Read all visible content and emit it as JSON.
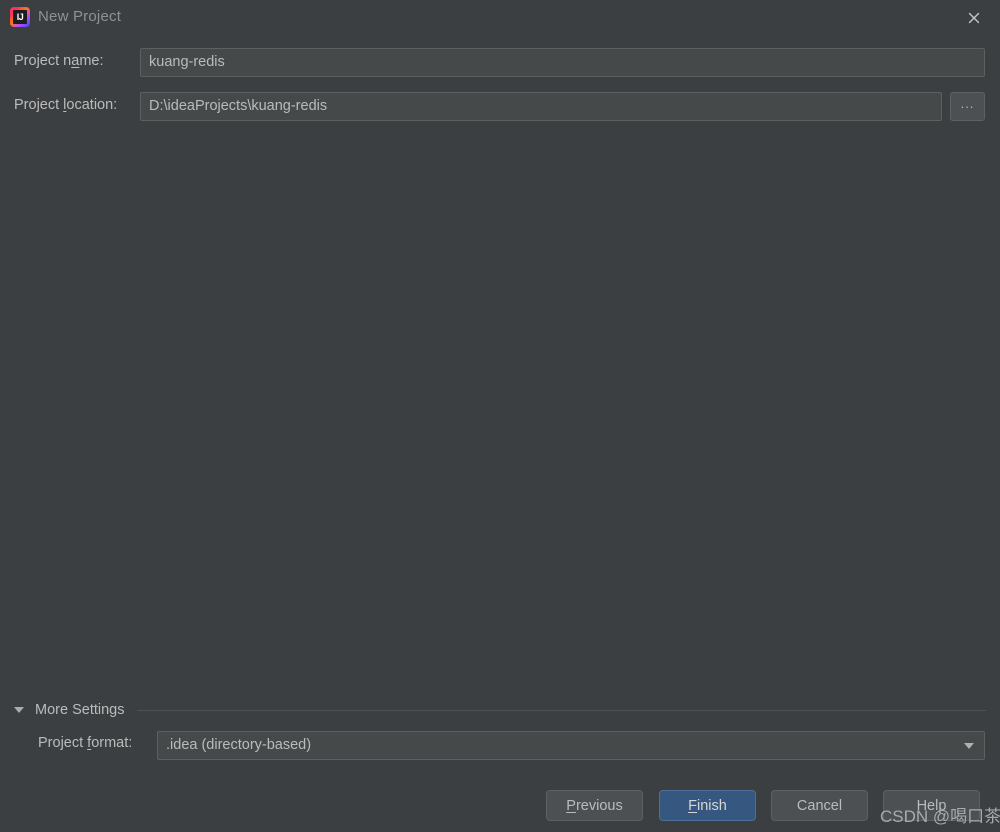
{
  "window": {
    "title": "New Project",
    "app_icon": "intellij-idea-icon",
    "icon_glyph": "IJ",
    "close_icon": "close-icon"
  },
  "form": {
    "project_name": {
      "label_before": "Project n",
      "label_mnemonic": "a",
      "label_after": "me:",
      "value": "kuang-redis"
    },
    "project_location": {
      "label_before": "Project ",
      "label_mnemonic": "l",
      "label_after": "ocation:",
      "value": "D:\\ideaProjects\\kuang-redis",
      "browse_label": "...",
      "browse_icon": "ellipsis-icon"
    }
  },
  "more_settings": {
    "label_before": "Mo",
    "label_mnemonic": "r",
    "label_after": "e Settings",
    "expanded": true,
    "collapse_icon": "triangle-down-icon",
    "project_format": {
      "label_before": "Project ",
      "label_mnemonic": "f",
      "label_after": "ormat:",
      "selected": ".idea (directory-based)",
      "dropdown_icon": "chevron-down-icon"
    }
  },
  "buttons": {
    "previous": {
      "before": "",
      "mnemonic": "P",
      "after": "revious"
    },
    "finish": {
      "before": "",
      "mnemonic": "F",
      "after": "inish"
    },
    "cancel": {
      "before": "Cancel",
      "mnemonic": "",
      "after": ""
    },
    "help": {
      "before": "Help",
      "mnemonic": "",
      "after": ""
    }
  },
  "watermark": {
    "text": "CSDN @喝口茶"
  },
  "colors": {
    "background": "#3c3f41",
    "field_background": "#45494a",
    "border": "#5e6060",
    "text": "#bbbbbb",
    "title_text": "#8f9193",
    "accent_button": "#365880",
    "accent_button_border": "#4c7099"
  }
}
